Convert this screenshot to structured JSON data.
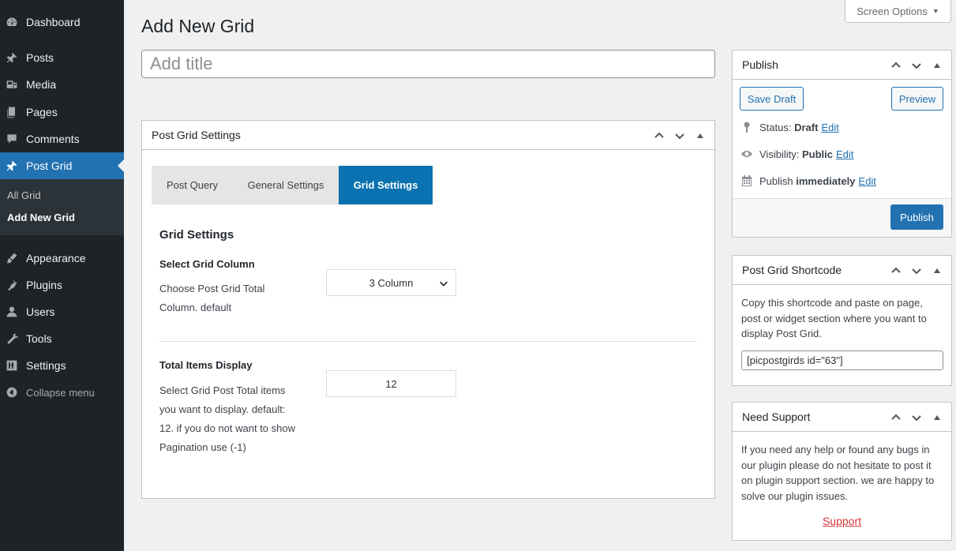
{
  "sidebar": {
    "items": [
      {
        "label": "Dashboard",
        "icon": "dashboard-icon"
      },
      {
        "label": "Posts",
        "icon": "pin-icon"
      },
      {
        "label": "Media",
        "icon": "media-icon"
      },
      {
        "label": "Pages",
        "icon": "pages-icon"
      },
      {
        "label": "Comments",
        "icon": "comment-icon"
      },
      {
        "label": "Post Grid",
        "icon": "pin-icon",
        "active": true
      },
      {
        "label": "Appearance",
        "icon": "brush-icon"
      },
      {
        "label": "Plugins",
        "icon": "plugin-icon"
      },
      {
        "label": "Users",
        "icon": "user-icon"
      },
      {
        "label": "Tools",
        "icon": "wrench-icon"
      },
      {
        "label": "Settings",
        "icon": "settings-icon"
      },
      {
        "label": "Collapse menu",
        "icon": "collapse-icon"
      }
    ],
    "submenu": [
      {
        "label": "All Grid"
      },
      {
        "label": "Add New Grid",
        "current": true
      }
    ]
  },
  "screen_options": {
    "label": "Screen Options",
    "icon": "caret-down-icon"
  },
  "page": {
    "title": "Add New Grid",
    "title_placeholder": "Add title"
  },
  "grid_box": {
    "title": "Post Grid Settings",
    "tabs": [
      {
        "label": "Post Query"
      },
      {
        "label": "General Settings"
      },
      {
        "label": "Grid Settings",
        "active": true
      }
    ],
    "section_title": "Grid Settings",
    "column": {
      "label": "Select Grid Column",
      "desc_line1": "Choose Post Grid Total",
      "desc_line2": "Column. default",
      "value": "3 Column"
    },
    "items": {
      "label": "Total Items Display",
      "desc_line1": "Select Grid Post Total items",
      "desc_line2": "you want to display. default:",
      "desc_line3": "12. if you do not want to show",
      "desc_line4": "Pagination use (-1)",
      "value": "12"
    }
  },
  "publish": {
    "title": "Publish",
    "save_draft": "Save Draft",
    "preview": "Preview",
    "status_label": "Status:",
    "status_value": "Draft",
    "visibility_label": "Visibility:",
    "visibility_value": "Public",
    "publish_label": "Publish",
    "publish_value": "immediately",
    "edit": "Edit",
    "publish_button": "Publish"
  },
  "shortcode": {
    "title": "Post Grid Shortcode",
    "desc_line1": "Copy this shortcode and paste on page,",
    "desc_line2": "post or widget section where you want to",
    "desc_line3": "display Post Grid.",
    "value": "[picpostgirds id=\"63\"]"
  },
  "support": {
    "title": "Need Support",
    "desc_line1": "If you need any help or found any bugs in",
    "desc_line2": "our plugin please do not hesitate to post it",
    "desc_line3": "on plugin support section. we are happy to",
    "desc_line4": "solve our plugin issues.",
    "link": "Support"
  },
  "colors": {
    "sidebar_bg": "#1d2327",
    "accent": "#2271b1",
    "tab_active": "#0a72b0",
    "support_link": "#d63638"
  }
}
